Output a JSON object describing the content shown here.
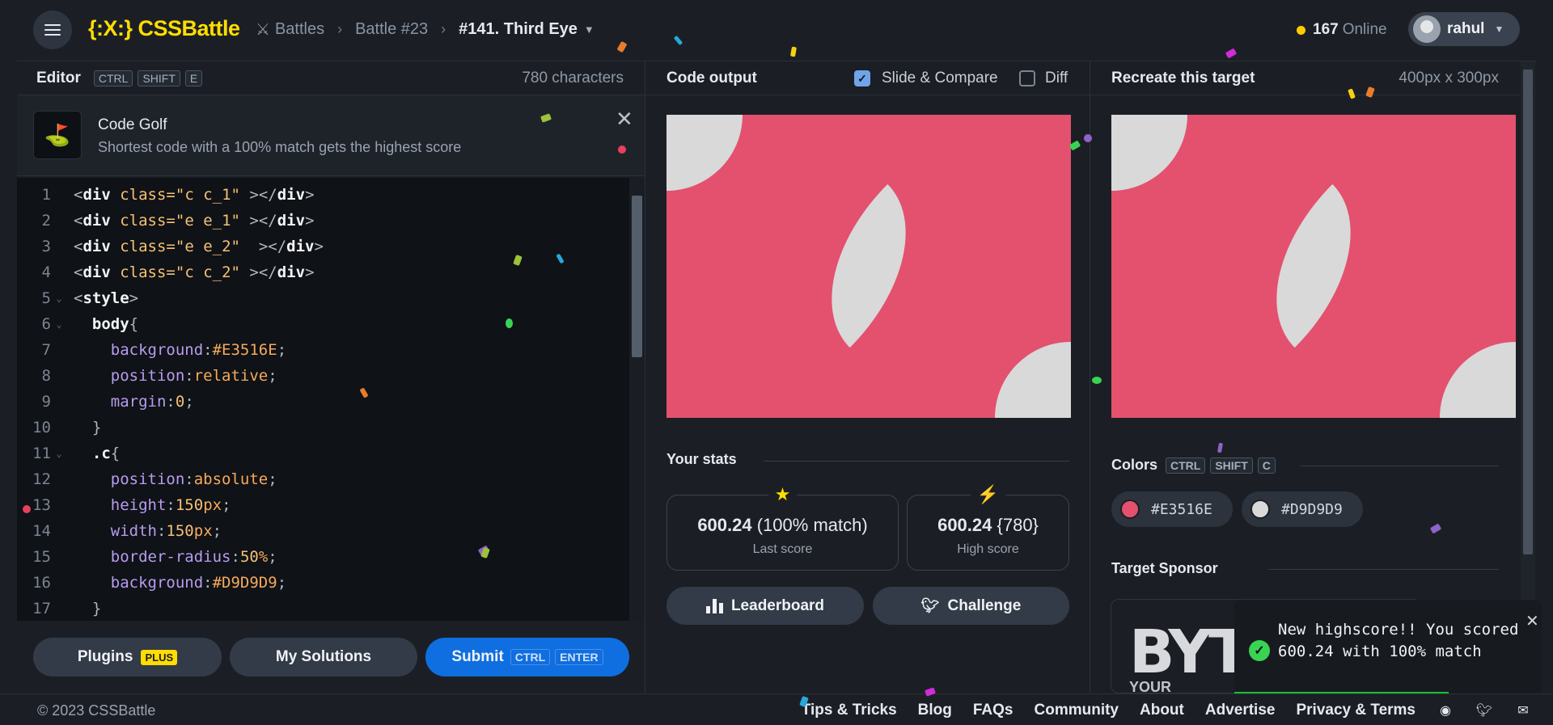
{
  "topbar": {
    "logo": "{:X:} CSSBattle",
    "breadcrumbs": [
      "Battles",
      "Battle #23",
      "#141. Third Eye"
    ],
    "online_count": "167",
    "online_label": "Online",
    "user_name": "rahul"
  },
  "editor": {
    "title": "Editor",
    "shortcut": [
      "CTRL",
      "SHIFT",
      "E"
    ],
    "char_count": "780 characters",
    "golf_title": "Code Golf",
    "golf_subtitle": "Shortest code with a 100% match gets the highest score",
    "lines": [
      {
        "n": "1",
        "fold": false
      },
      {
        "n": "2",
        "fold": false
      },
      {
        "n": "3",
        "fold": false
      },
      {
        "n": "4",
        "fold": false
      },
      {
        "n": "5",
        "fold": true
      },
      {
        "n": "6",
        "fold": true
      },
      {
        "n": "7",
        "fold": false
      },
      {
        "n": "8",
        "fold": false
      },
      {
        "n": "9",
        "fold": false
      },
      {
        "n": "10",
        "fold": false
      },
      {
        "n": "11",
        "fold": true
      },
      {
        "n": "12",
        "fold": false
      },
      {
        "n": "13",
        "fold": false
      },
      {
        "n": "14",
        "fold": false
      },
      {
        "n": "15",
        "fold": false
      },
      {
        "n": "16",
        "fold": false
      },
      {
        "n": "17",
        "fold": false
      }
    ],
    "buttons": {
      "plugins": "Plugins",
      "plus_badge": "PLUS",
      "my_solutions": "My Solutions",
      "submit": "Submit",
      "submit_keys": [
        "CTRL",
        "ENTER"
      ]
    }
  },
  "output": {
    "title": "Code output",
    "slide_compare": "Slide & Compare",
    "slide_compare_checked": true,
    "diff": "Diff",
    "diff_checked": false,
    "stats_title": "Your stats",
    "last_score_value": "600.24",
    "last_score_extra": "(100% match)",
    "last_score_label": "Last score",
    "high_score_value": "600.24",
    "high_score_extra": "{780}",
    "high_score_label": "High score",
    "leaderboard": "Leaderboard",
    "challenge": "Challenge"
  },
  "target": {
    "title": "Recreate this target",
    "size": "400px x 300px",
    "colors_title": "Colors",
    "colors_shortcut": [
      "CTRL",
      "SHIFT",
      "C"
    ],
    "colors": [
      {
        "hex": "#E3516E"
      },
      {
        "hex": "#D9D9D9"
      }
    ],
    "sponsor_title": "Target Sponsor",
    "sponsor_logo": "BYT",
    "sponsor_tagline": "YOUR"
  },
  "toast": {
    "message": "New highscore!! You scored 600.24 with 100% match"
  },
  "footer": {
    "copyright": "© 2023 CSSBattle",
    "links": [
      "Tips & Tricks",
      "Blog",
      "FAQs",
      "Community",
      "About",
      "Advertise",
      "Privacy & Terms"
    ]
  },
  "colors": {
    "brand": "#ffdd00",
    "target_bg": "#E3516E",
    "target_shape": "#D9D9D9",
    "submit": "#0f6ee0",
    "success": "#39d353"
  }
}
